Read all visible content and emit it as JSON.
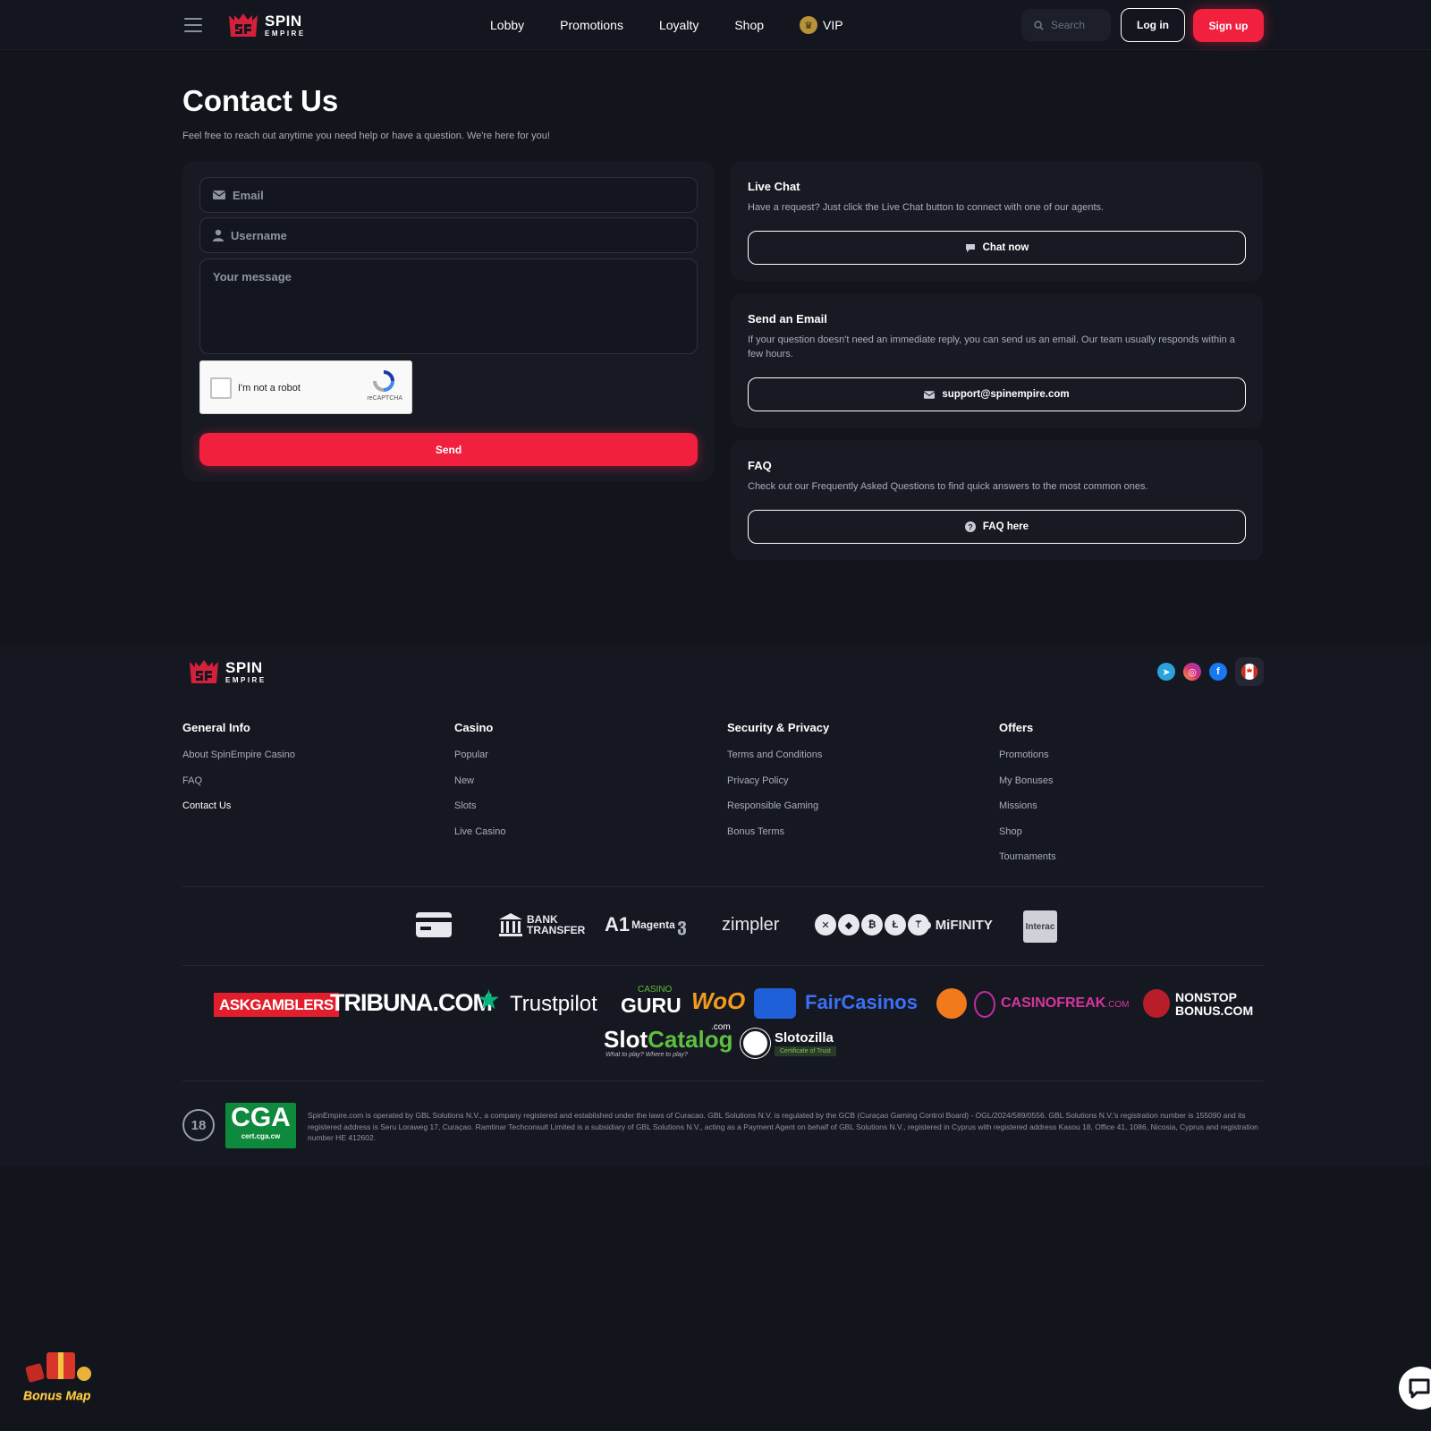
{
  "header": {
    "logo": {
      "word1": "SPIN",
      "word2": "EMPIRE"
    },
    "nav": [
      "Lobby",
      "Promotions",
      "Loyalty",
      "Shop"
    ],
    "vip_label": "VIP",
    "search_placeholder": "Search",
    "login_label": "Log in",
    "signup_label": "Sign up"
  },
  "main": {
    "title": "Contact Us",
    "subtitle": "Feel free to reach out anytime you need help or have a question. We're here for you!",
    "form": {
      "email_placeholder": "Email",
      "username_placeholder": "Username",
      "message_placeholder": "Your message",
      "captcha_label": "I'm not a robot",
      "captcha_brand": "reCAPTCHA",
      "send_label": "Send"
    },
    "cards": {
      "chat": {
        "title": "Live Chat",
        "text": "Have a request? Just click the Live Chat button to connect with one of our agents.",
        "button": "Chat now"
      },
      "email": {
        "title": "Send an Email",
        "text": "If your question doesn't need an immediate reply, you can send us an email. Our team usually responds within a few hours.",
        "button": "support@spinempire.com"
      },
      "faq": {
        "title": "FAQ",
        "text": "Check out our Frequently Asked Questions to find quick answers to the most common ones.",
        "button": "FAQ here"
      }
    }
  },
  "footer": {
    "columns": [
      {
        "title": "General Info",
        "links": [
          "About SpinEmpire Casino",
          "FAQ",
          "Contact Us"
        ]
      },
      {
        "title": "Casino",
        "links": [
          "Popular",
          "New",
          "Slots",
          "Live Casino"
        ]
      },
      {
        "title": "Security & Privacy",
        "links": [
          "Terms and Conditions",
          "Privacy Policy",
          "Responsible Gaming",
          "Bonus Terms"
        ]
      },
      {
        "title": "Offers",
        "links": [
          "Promotions",
          "My Bonuses",
          "Missions",
          "Shop",
          "Tournaments"
        ]
      }
    ],
    "payments": {
      "bank_line1": "BANK",
      "bank_line2": "TRANSFER",
      "a1": "A1",
      "magenta": "Magenta",
      "zimpler": "zimpler",
      "mifinity": "MiFINITY",
      "interac": "Interac"
    },
    "partners": {
      "askgamblers": "ASKGAMBLERS",
      "tribuna": "TRIBUNA.COM",
      "trustpilot": "Trustpilot",
      "casino_small": "CASINO",
      "guru": "GURU",
      "woo": "WoO",
      "faircasinos": "FairCasinos",
      "casinofreak_main": "CASINOFREAK",
      "casinofreak_dom": ".COM",
      "nonstop1": "NONSTOP",
      "nonstop2": "BONUS.COM",
      "slot": "Slot",
      "catalog": "Catalog",
      "catalog_dom": ".com",
      "catalog_tag": "What to play? Where to play?",
      "slotozilla": "Slotozilla",
      "slotozilla_tag": "Certificate of Trust"
    },
    "age_badge": "18",
    "cga_main": "CGA",
    "cga_sub": "cert.cga.cw",
    "legal": "SpinEmpire.com is operated by GBL Solutions N.V., a company registered and established under the laws of Curacao. GBL Solutions N.V. is regulated by the GCB (Curaçao Gaming Control Board) - OGL/2024/589/0556. GBL Solutions N.V.'s registration number is 155090 and its registered address is Seru Loraweg 17, Curaçao. Ramtinar Techconsult Limited is a subsidiary of GBL Solutions N.V., acting as a Payment Agent on behalf of GBL Solutions N.V., registered in Cyprus with registered address Kasou 18, Office 41, 1086, Nicosia, Cyprus and registration number HE 412602."
  },
  "bonus_map_label": "Bonus Map",
  "colors": {
    "accent": "#f0203e",
    "bg": "#13151d",
    "card": "#181a23"
  }
}
